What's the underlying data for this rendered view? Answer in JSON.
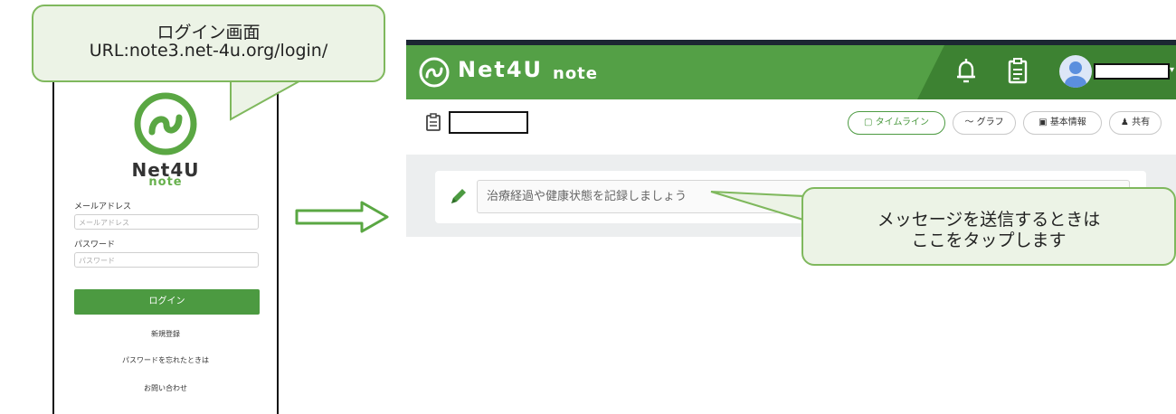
{
  "callouts": {
    "login_title": "ログイン画面",
    "login_url": "URL:note3.net-4u.org/login/",
    "message_line1": "メッセージを送信するときは",
    "message_line2": "ここをタップします"
  },
  "login": {
    "brand_name": "Net4U",
    "brand_sub": "note",
    "email_label": "メールアドレス",
    "email_placeholder": "メールアドレス",
    "password_label": "パスワード",
    "password_placeholder": "パスワード",
    "login_button": "ログイン",
    "register_link": "新規登録",
    "forgot_link": "パスワードを忘れたときは",
    "contact_link": "お問い合わせ"
  },
  "app": {
    "title": "Net4U",
    "title_suffix": "note",
    "tabs": [
      {
        "label": "タイムライン",
        "icon": "calendar-icon",
        "active": true
      },
      {
        "label": "グラフ",
        "icon": "chart-line-icon",
        "active": false
      },
      {
        "label": "基本情報",
        "icon": "id-card-icon",
        "active": false
      },
      {
        "label": "共有",
        "icon": "people-icon",
        "active": false
      }
    ],
    "message_placeholder": "治療経過や健康状態を記録しましょう"
  },
  "colors": {
    "brand_green": "#54a046",
    "brand_green_dark": "#3d8232",
    "button_green": "#4c9a41",
    "callout_fill": "#ecf3e6",
    "callout_border": "#7fb85d"
  }
}
